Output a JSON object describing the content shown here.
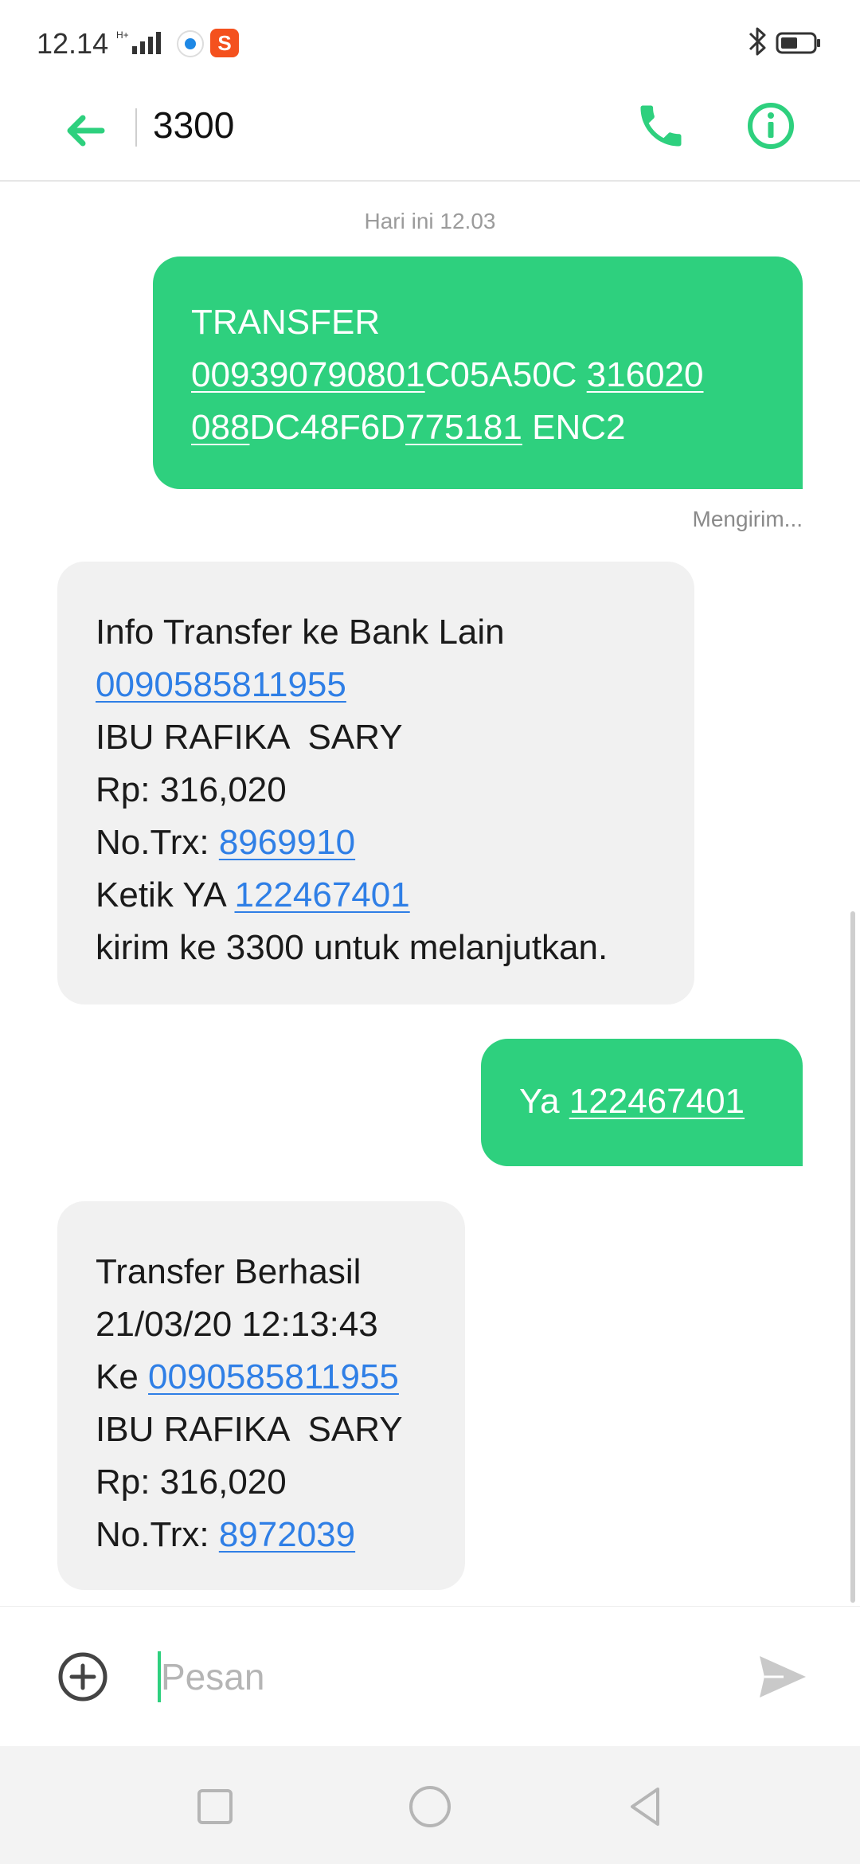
{
  "status_bar": {
    "time": "12.14",
    "network": "H+",
    "app_badge": "S",
    "bluetooth_icon": "bluetooth-icon",
    "battery_icon": "battery-icon"
  },
  "header": {
    "title": "3300",
    "back_icon": "arrow-left-icon",
    "call_icon": "phone-icon",
    "info_icon": "info-icon"
  },
  "conversation": {
    "date_label": "Hari ini 12.03",
    "messages": [
      {
        "direction": "out",
        "lines": [
          [
            {
              "t": "TRANSFER"
            }
          ],
          [
            {
              "t": "009390790801",
              "link": true
            },
            {
              "t": "C05A50C "
            },
            {
              "t": "316020",
              "link": true
            }
          ],
          [
            {
              "t": "088",
              "link": true
            },
            {
              "t": "DC48F6D"
            },
            {
              "t": "775181",
              "link": true
            },
            {
              "t": " ENC2"
            }
          ]
        ],
        "status": "Mengirim..."
      },
      {
        "direction": "in",
        "lines": [
          [
            {
              "t": "Info Transfer ke Bank Lain"
            }
          ],
          [
            {
              "t": "0090585811955",
              "link": true
            }
          ],
          [
            {
              "t": "IBU RAFIKA  SARY"
            }
          ],
          [
            {
              "t": "Rp: 316,020"
            }
          ],
          [
            {
              "t": "No.Trx: "
            },
            {
              "t": "8969910",
              "link": true
            }
          ],
          [
            {
              "t": "Ketik YA "
            },
            {
              "t": "122467401",
              "link": true
            }
          ],
          [
            {
              "t": "kirim ke 3300 untuk melanjutkan."
            }
          ]
        ]
      },
      {
        "direction": "out",
        "lines": [
          [
            {
              "t": "Ya "
            },
            {
              "t": "122467401",
              "link": true
            }
          ]
        ]
      },
      {
        "direction": "in",
        "lines": [
          [
            {
              "t": "Transfer Berhasil"
            }
          ],
          [
            {
              "t": "21/03/20 12:13:43"
            }
          ],
          [
            {
              "t": "Ke "
            },
            {
              "t": "0090585811955",
              "link": true
            }
          ],
          [
            {
              "t": "IBU RAFIKA  SARY"
            }
          ],
          [
            {
              "t": "Rp: 316,020"
            }
          ],
          [
            {
              "t": "No.Trx: "
            },
            {
              "t": "8972039",
              "link": true
            }
          ]
        ]
      }
    ]
  },
  "composer": {
    "placeholder": "Pesan",
    "value": "",
    "attach_icon": "plus-circle-icon",
    "send_icon": "send-icon"
  },
  "nav_bar": {
    "recent_icon": "square-icon",
    "home_icon": "circle-icon",
    "back_icon": "triangle-back-icon"
  },
  "colors": {
    "accent": "#2ed07e",
    "incoming_bubble": "#f1f1f1",
    "link": "#2f7fe6",
    "muted_text": "#9b9b9b"
  }
}
